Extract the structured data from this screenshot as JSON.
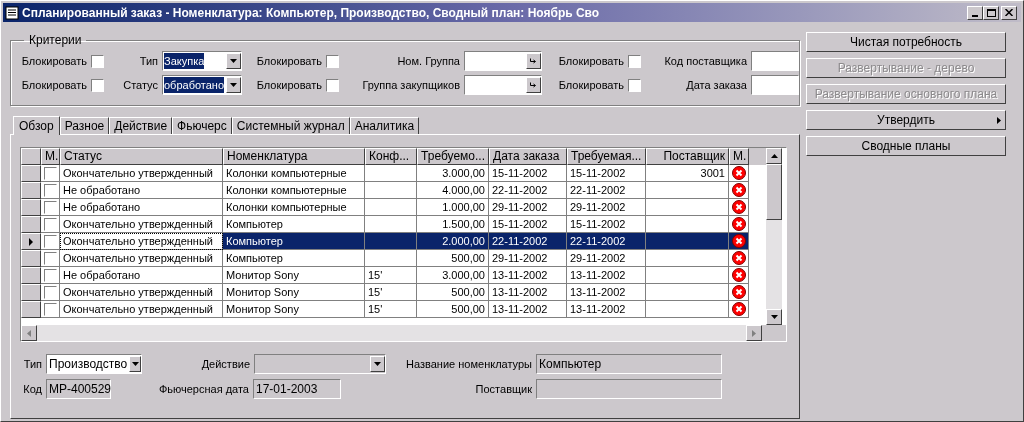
{
  "window": {
    "title": "Спланированный заказ - Номенклатура: Компьютер, Производство, Сводный план: Ноябрь Сво"
  },
  "criteria": {
    "legend": "Критерии",
    "rows": [
      [
        {
          "kind": "check",
          "label": "Блокировать",
          "checked": false
        },
        {
          "kind": "combo",
          "label": "Тип",
          "value": "Закупка"
        },
        {
          "kind": "check",
          "label": "Блокировать",
          "checked": false
        },
        {
          "kind": "lookup",
          "label": "Ном. Группа"
        },
        {
          "kind": "check",
          "label": "Блокировать",
          "checked": false
        },
        {
          "kind": "field",
          "label": "Код поставщика"
        }
      ],
      [
        {
          "kind": "check",
          "label": "Блокировать",
          "checked": false
        },
        {
          "kind": "combo",
          "label": "Статус",
          "value": "обработано"
        },
        {
          "kind": "check",
          "label": "Блокировать",
          "checked": false
        },
        {
          "kind": "lookup",
          "label": "Группа закупщиков"
        },
        {
          "kind": "check",
          "label": "Блокировать",
          "checked": false
        },
        {
          "kind": "field",
          "label": "Дата заказа"
        }
      ]
    ]
  },
  "buttons": [
    {
      "label": "Чистая потребность",
      "disabled": false,
      "submenu": false
    },
    {
      "label": "Развертывание - дерево",
      "disabled": true,
      "submenu": false
    },
    {
      "label": "Развертывание основного плана",
      "disabled": true,
      "submenu": false
    },
    {
      "label": "Утвердить",
      "disabled": false,
      "submenu": true
    },
    {
      "label": "Сводные планы",
      "disabled": false,
      "submenu": false
    }
  ],
  "tabs": [
    {
      "label": "Обзор",
      "selected": true
    },
    {
      "label": "Разное",
      "selected": false
    },
    {
      "label": "Действие",
      "selected": false
    },
    {
      "label": "Фьючерс",
      "selected": false
    },
    {
      "label": "Системный журнал",
      "selected": false
    },
    {
      "label": "Аналитика",
      "selected": false
    }
  ],
  "table": {
    "columns": [
      "M.",
      "Статус",
      "Номенклатура",
      "Конф...",
      "Требуемо...",
      "Дата заказа",
      "Требуемая...",
      "Поставщик",
      "M."
    ],
    "rows": [
      {
        "selected": false,
        "checked": false,
        "status": "Окончательно утвержденный",
        "item": "Колонки компьютерные",
        "qty": "3.000,00",
        "order_date": "15-11-2002",
        "required_date": "15-11-2002",
        "vendor": "3001"
      },
      {
        "selected": false,
        "checked": false,
        "status": "Не обработано",
        "item": "Колонки компьютерные",
        "qty": "4.000,00",
        "order_date": "22-11-2002",
        "required_date": "22-11-2002"
      },
      {
        "selected": false,
        "checked": false,
        "status": "Не обработано",
        "item": "Колонки компьютерные",
        "qty": "1.000,00",
        "order_date": "29-11-2002",
        "required_date": "29-11-2002"
      },
      {
        "selected": false,
        "checked": false,
        "status": "Окончательно утвержденный",
        "item": "Компьютер",
        "qty": "1.500,00",
        "order_date": "15-11-2002",
        "required_date": "15-11-2002"
      },
      {
        "selected": true,
        "checked": false,
        "status": "Окончательно утвержденный",
        "item": "Компьютер",
        "qty": "2.000,00",
        "order_date": "22-11-2002",
        "required_date": "22-11-2002"
      },
      {
        "selected": false,
        "checked": false,
        "status": "Окончательно утвержденный",
        "item": "Компьютер",
        "qty": "500,00",
        "order_date": "29-11-2002",
        "required_date": "29-11-2002"
      },
      {
        "selected": false,
        "checked": false,
        "status": "Не обработано",
        "item": "Монитор Sony",
        "config": "15'",
        "qty": "3.000,00",
        "order_date": "13-11-2002",
        "required_date": "13-11-2002"
      },
      {
        "selected": false,
        "checked": false,
        "status": "Окончательно утвержденный",
        "item": "Монитор Sony",
        "config": "15'",
        "qty": "500,00",
        "order_date": "13-11-2002",
        "required_date": "13-11-2002"
      },
      {
        "selected": false,
        "checked": false,
        "status": "Окончательно утвержденный",
        "item": "Монитор Sony",
        "config": "15'",
        "qty": "500,00",
        "order_date": "13-11-2002",
        "required_date": "13-11-2002"
      }
    ]
  },
  "details": {
    "rows": [
      [
        {
          "kind": "combo",
          "label": "Тип",
          "value": "Производство"
        },
        {
          "kind": "combo",
          "label": "Действие"
        },
        {
          "kind": "field",
          "label": "Название номенклатуры",
          "value": "Компьютер"
        }
      ],
      [
        {
          "kind": "field",
          "label": "Код",
          "value": "MP-400529"
        },
        {
          "kind": "field",
          "label": "Фьючерсная дата",
          "value": "17-01-2003"
        },
        {
          "kind": "field",
          "label": "Поставщик"
        }
      ]
    ]
  }
}
